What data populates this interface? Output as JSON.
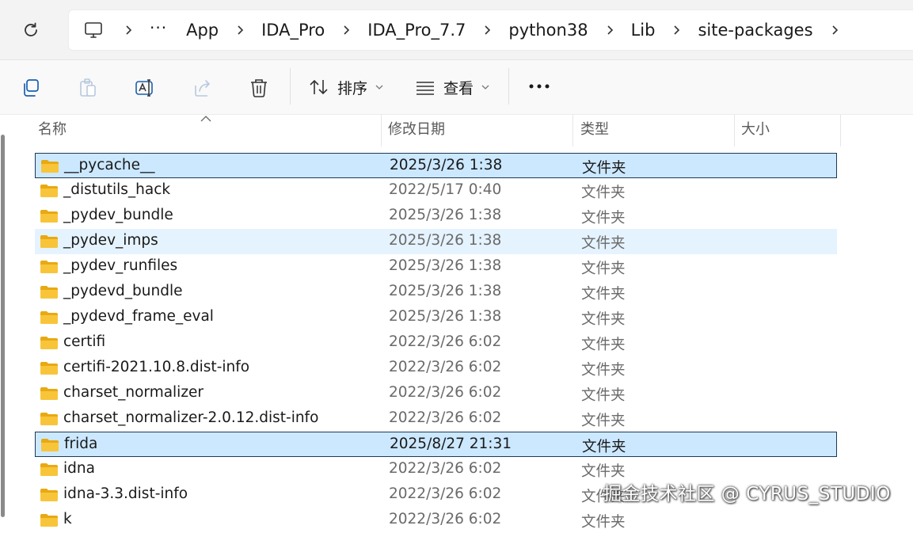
{
  "address": {
    "breadcrumbs": [
      "App",
      "IDA_Pro",
      "IDA_Pro_7.7",
      "python38",
      "Lib",
      "site-packages"
    ],
    "overflow_label": "···"
  },
  "toolbar": {
    "sort_label": "排序",
    "view_label": "查看",
    "more_label": "···"
  },
  "columns": {
    "name": "名称",
    "date": "修改日期",
    "type": "类型",
    "size": "大小"
  },
  "files": [
    {
      "name": "__pycache__",
      "date": "2025/3/26 1:38",
      "type": "文件夹",
      "state": "selected"
    },
    {
      "name": "_distutils_hack",
      "date": "2022/5/17 0:40",
      "type": "文件夹",
      "state": ""
    },
    {
      "name": "_pydev_bundle",
      "date": "2025/3/26 1:38",
      "type": "文件夹",
      "state": ""
    },
    {
      "name": "_pydev_imps",
      "date": "2025/3/26 1:38",
      "type": "文件夹",
      "state": "hover"
    },
    {
      "name": "_pydev_runfiles",
      "date": "2025/3/26 1:38",
      "type": "文件夹",
      "state": ""
    },
    {
      "name": "_pydevd_bundle",
      "date": "2025/3/26 1:38",
      "type": "文件夹",
      "state": ""
    },
    {
      "name": "_pydevd_frame_eval",
      "date": "2025/3/26 1:38",
      "type": "文件夹",
      "state": ""
    },
    {
      "name": "certifi",
      "date": "2022/3/26 6:02",
      "type": "文件夹",
      "state": ""
    },
    {
      "name": "certifi-2021.10.8.dist-info",
      "date": "2022/3/26 6:02",
      "type": "文件夹",
      "state": ""
    },
    {
      "name": "charset_normalizer",
      "date": "2022/3/26 6:02",
      "type": "文件夹",
      "state": ""
    },
    {
      "name": "charset_normalizer-2.0.12.dist-info",
      "date": "2022/3/26 6:02",
      "type": "文件夹",
      "state": ""
    },
    {
      "name": "frida",
      "date": "2025/8/27 21:31",
      "type": "文件夹",
      "state": "selected"
    },
    {
      "name": "idna",
      "date": "2022/3/26 6:02",
      "type": "文件夹",
      "state": ""
    },
    {
      "name": "idna-3.3.dist-info",
      "date": "2022/3/26 6:02",
      "type": "文件夹",
      "state": ""
    },
    {
      "name": "k",
      "date": "2022/3/26 6:02",
      "type": "文件夹",
      "state": ""
    }
  ],
  "watermark": "掘金技术社区 @ CYRUS_STUDIO",
  "colors": {
    "selected_bg": "#cce8ff",
    "selected_border": "#1c3a56",
    "hover_bg": "#e5f3ff",
    "folder_yellow": "#f8c53a"
  }
}
